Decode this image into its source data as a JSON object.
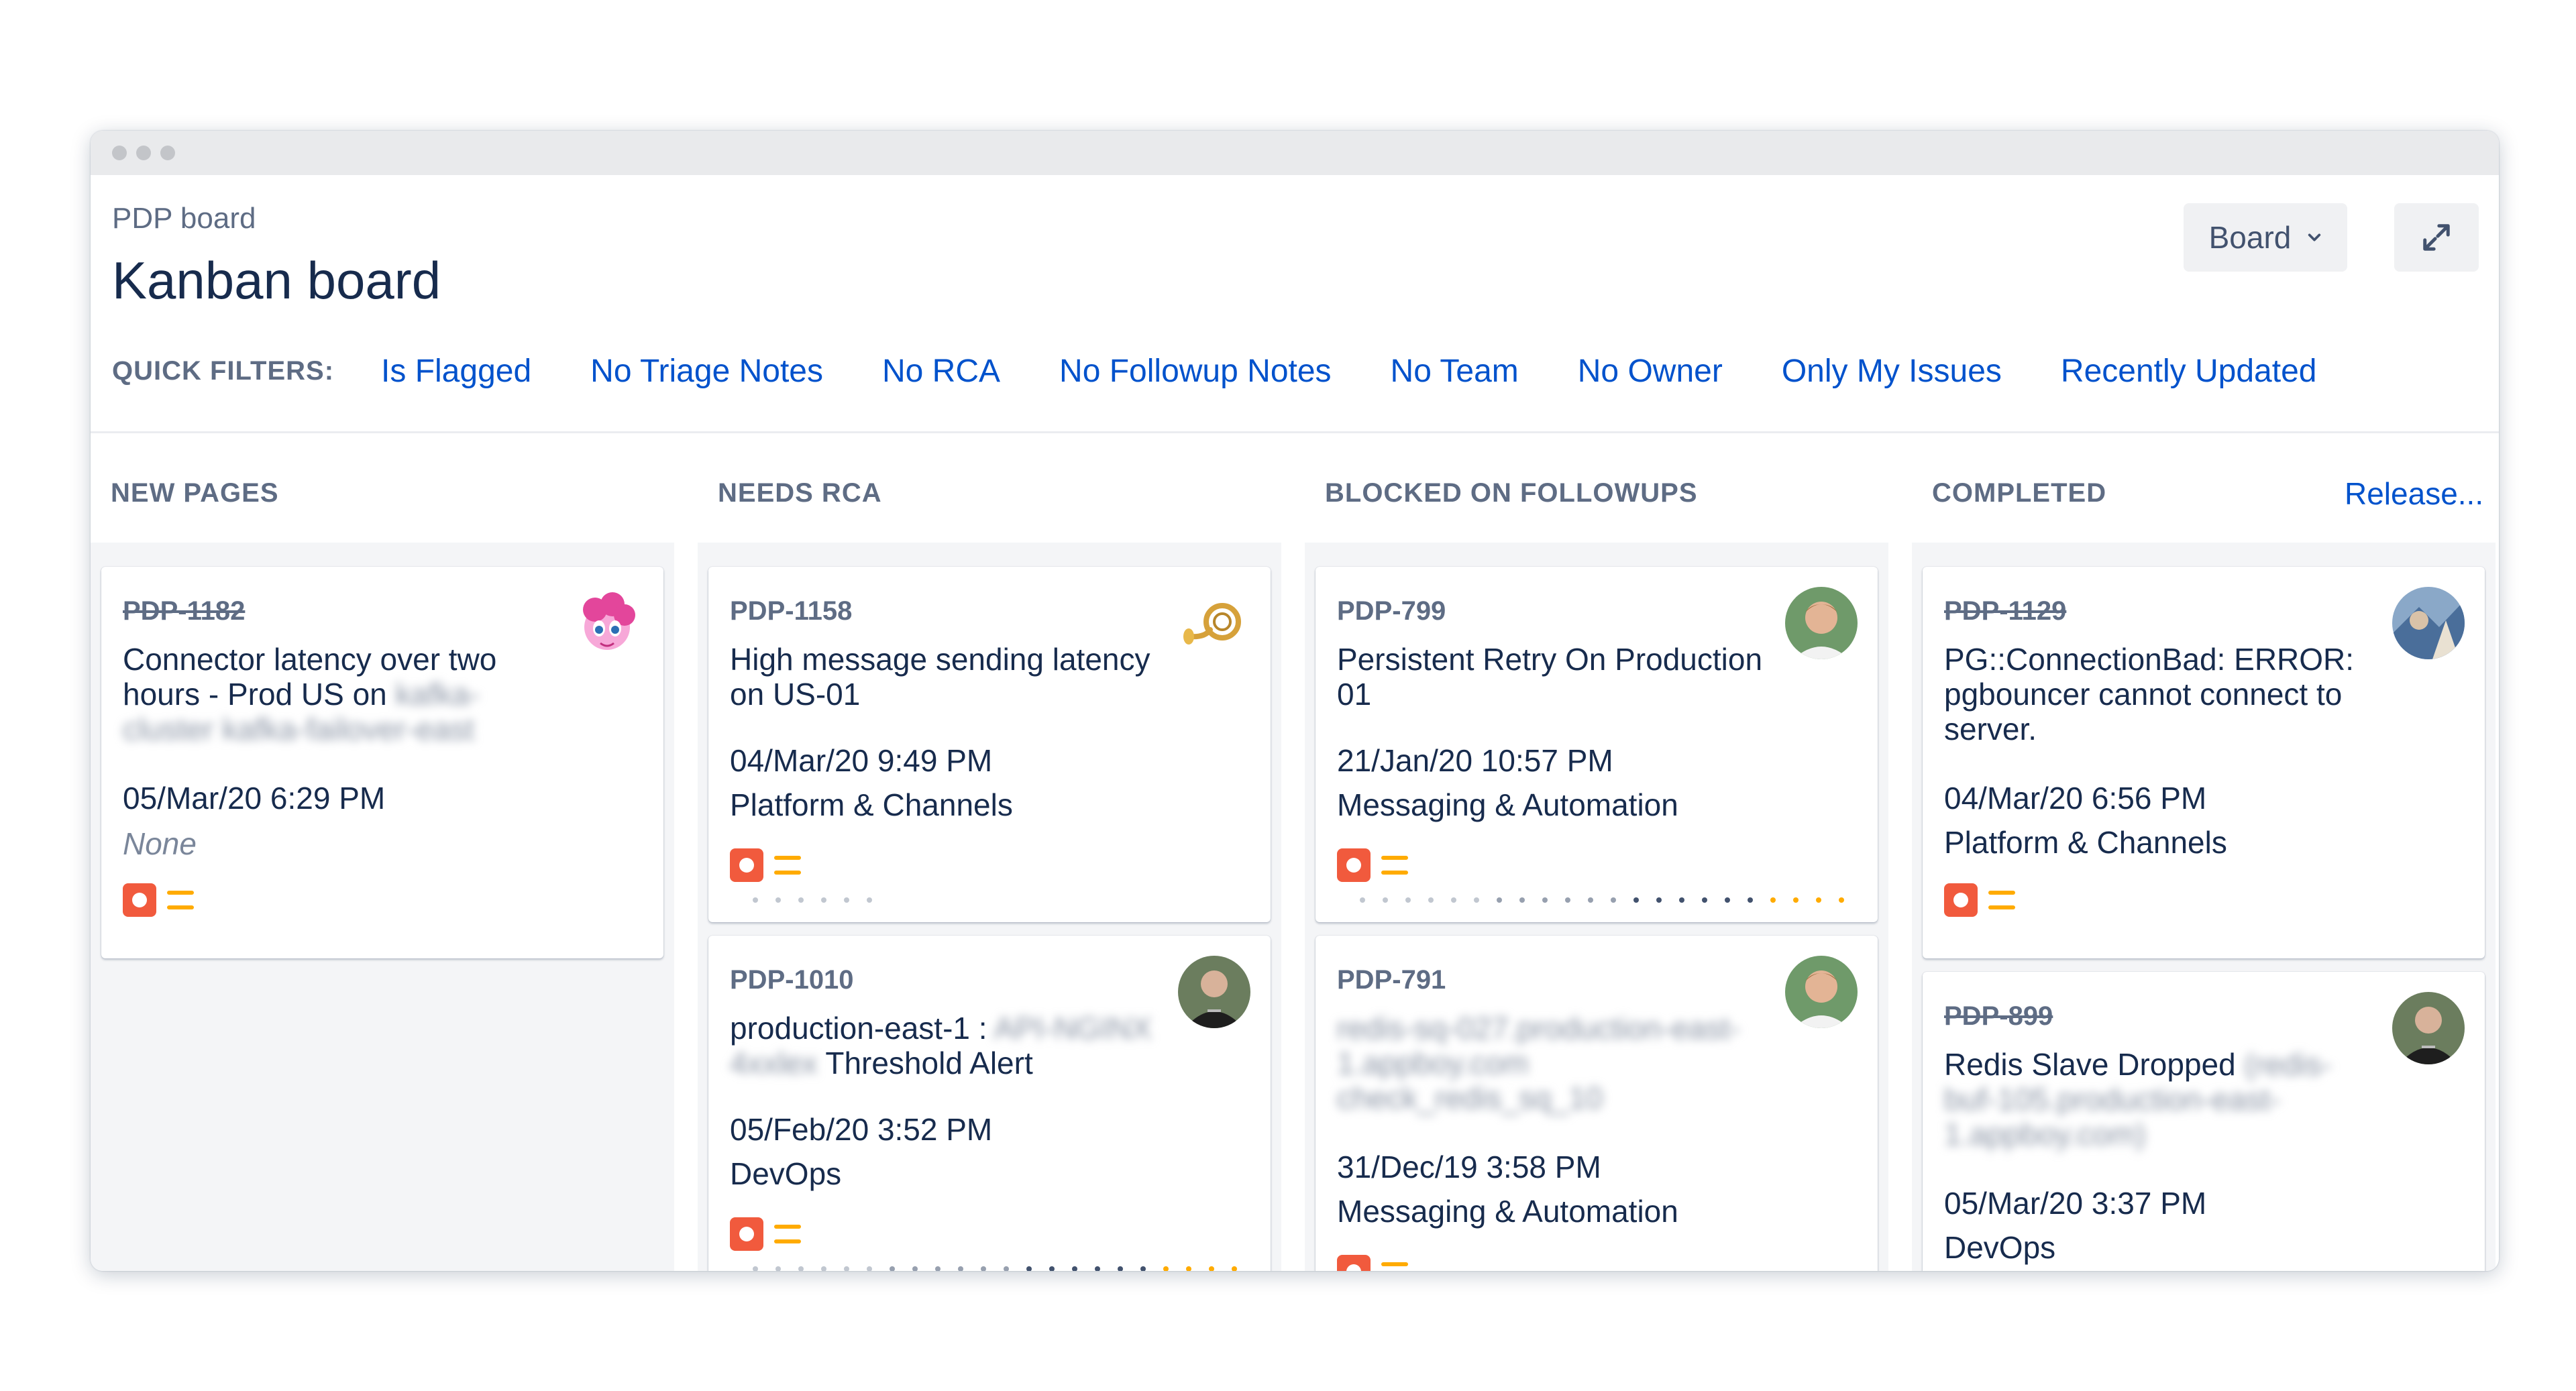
{
  "window": {
    "controls": [
      "close",
      "minimize",
      "maximize"
    ]
  },
  "header": {
    "board_name": "PDP board",
    "title": "Kanban board",
    "board_button": "Board",
    "expand_icon": "expand-icon"
  },
  "quick_filters": {
    "label": "QUICK FILTERS:",
    "items": [
      "Is Flagged",
      "No Triage Notes",
      "No RCA",
      "No Followup Notes",
      "No Team",
      "No Owner",
      "Only My Issues",
      "Recently Updated"
    ]
  },
  "columns": [
    {
      "name": "NEW PAGES"
    },
    {
      "name": "NEEDS RCA"
    },
    {
      "name": "BLOCKED ON FOLLOWUPS"
    },
    {
      "name": "COMPLETED",
      "action": "Release..."
    }
  ],
  "cards": {
    "c1": {
      "key": "PDP-1182",
      "summary": "Connector latency over two hours - Prod US on",
      "summary_blurred": "kafka-cluster kafka-failover-east",
      "date": "05/Mar/20 6:29 PM",
      "team": "None"
    },
    "c2": {
      "key": "PDP-1158",
      "summary": "High message sending latency on US-01",
      "date": "04/Mar/20 9:49 PM",
      "team": "Platform & Channels"
    },
    "c3": {
      "key": "PDP-1010",
      "summary_start": "production-east-1 :",
      "summary_blurred": "API-NGINX 4xxlex",
      "summary_end": "Threshold Alert",
      "date": "05/Feb/20 3:52 PM",
      "team": "DevOps"
    },
    "c4": {
      "key": "PDP-799",
      "summary": "Persistent Retry On Production 01",
      "date": "21/Jan/20 10:57 PM",
      "team": "Messaging & Automation"
    },
    "c5": {
      "key": "PDP-791",
      "summary_blurred": "redis-sq-027.production-east-1.appboy.com check_redis_sq_10",
      "date": "31/Dec/19 3:58 PM",
      "team": "Messaging & Automation"
    },
    "c6": {
      "key": "PDP-1129",
      "summary": "PG::ConnectionBad: ERROR: pgbouncer cannot connect to server.",
      "date": "04/Mar/20 6:56 PM",
      "team": "Platform & Channels"
    },
    "c7": {
      "key": "PDP-899",
      "summary": "Redis Slave Dropped",
      "summary_blurred": "(redis-buf-105.production-east-1.appboy.com)",
      "date": "05/Mar/20 3:37 PM",
      "team": "DevOps"
    }
  },
  "icons": {
    "issue_type": "incident-icon",
    "priority": "medium-priority-icon"
  },
  "colors": {
    "link": "#0052cc",
    "incident": "#f15a3d",
    "priority": "#ffab00",
    "column_bg": "#f4f5f7"
  }
}
